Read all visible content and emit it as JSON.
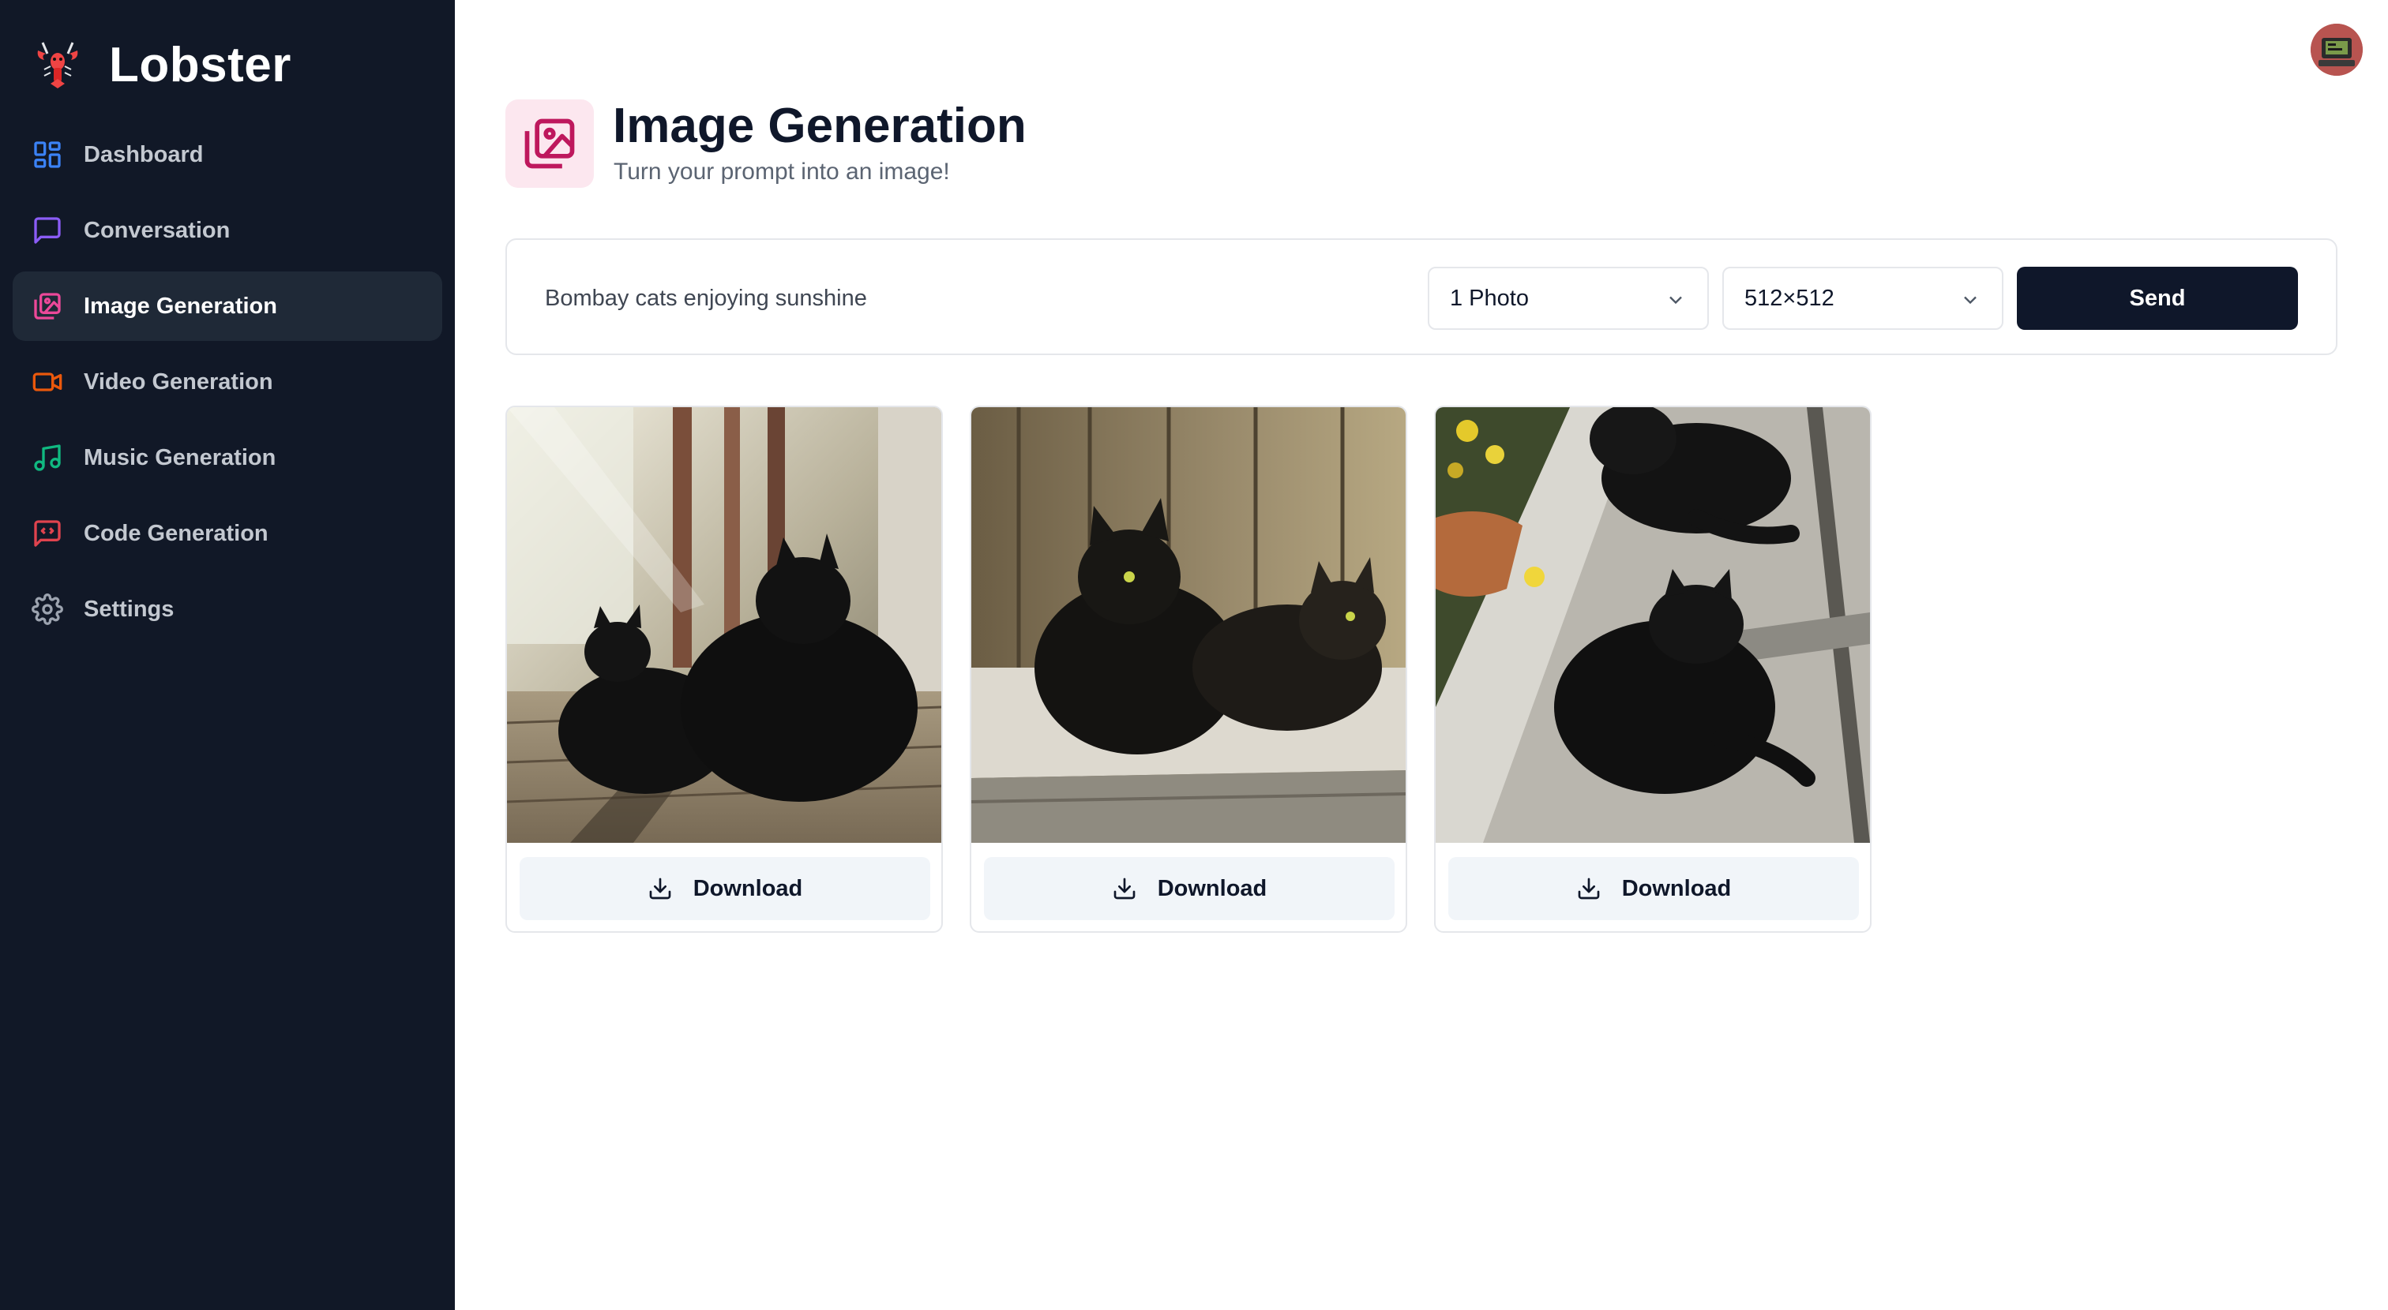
{
  "app": {
    "name": "Lobster"
  },
  "sidebar": {
    "items": [
      {
        "label": "Dashboard",
        "icon": "dashboard-icon",
        "color": "#3b82f6"
      },
      {
        "label": "Conversation",
        "icon": "message-square-icon",
        "color": "#8b5cf6"
      },
      {
        "label": "Image Generation",
        "icon": "images-icon",
        "color": "#ec4899",
        "active": true
      },
      {
        "label": "Video Generation",
        "icon": "video-icon",
        "color": "#ea580c"
      },
      {
        "label": "Music Generation",
        "icon": "music-icon",
        "color": "#10b981"
      },
      {
        "label": "Code Generation",
        "icon": "code-message-icon",
        "color": "#e0434e"
      },
      {
        "label": "Settings",
        "icon": "gear-icon",
        "color": "#9ca3af"
      }
    ]
  },
  "header": {
    "title": "Image Generation",
    "subtitle": "Turn your prompt into an image!",
    "icon": "images-icon",
    "accent": "#be185d"
  },
  "form": {
    "prompt_value": "Bombay cats enjoying sunshine",
    "amount_selected": "1 Photo",
    "resolution_selected": "512×512",
    "send_label": "Send"
  },
  "gallery": {
    "images": [
      {
        "alt": "Two black cats sitting on a sunny wooden deck",
        "download_label": "Download"
      },
      {
        "alt": "Two black cats lying by a wooden fence in sunlight",
        "download_label": "Download"
      },
      {
        "alt": "Two black cats lounging on a sunny patio next to a flower pot",
        "download_label": "Download"
      }
    ]
  },
  "colors": {
    "sidebar_bg": "#111827",
    "primary": "#0f172a",
    "active_item_bg": "#1f2937"
  }
}
